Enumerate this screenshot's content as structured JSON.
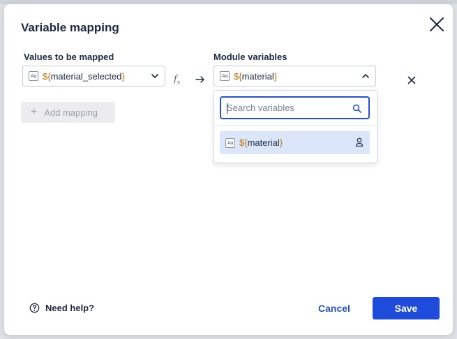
{
  "dialog": {
    "title": "Variable mapping"
  },
  "mapping": {
    "values_label": "Values to be mapped",
    "module_label": "Module variables",
    "source_var": {
      "type_icon": "Aa",
      "prefix": "${",
      "name": "material_selected",
      "suffix": "}"
    },
    "fx_label": "f",
    "fx_sub": "x",
    "target_var": {
      "type_icon": "Aa",
      "prefix": "${",
      "name": "material",
      "suffix": "}"
    },
    "add_mapping_label": "Add mapping"
  },
  "dropdown": {
    "search_placeholder": "Search variables",
    "options": [
      {
        "type_icon": "Aa",
        "prefix": "${",
        "name": "material",
        "suffix": "}",
        "icon": "user-icon"
      }
    ]
  },
  "footer": {
    "help_label": "Need help?",
    "cancel_label": "Cancel",
    "save_label": "Save"
  },
  "colors": {
    "primary": "#1f4bdb",
    "brace": "#c0720c",
    "option_highlight": "#dbe6fa"
  }
}
